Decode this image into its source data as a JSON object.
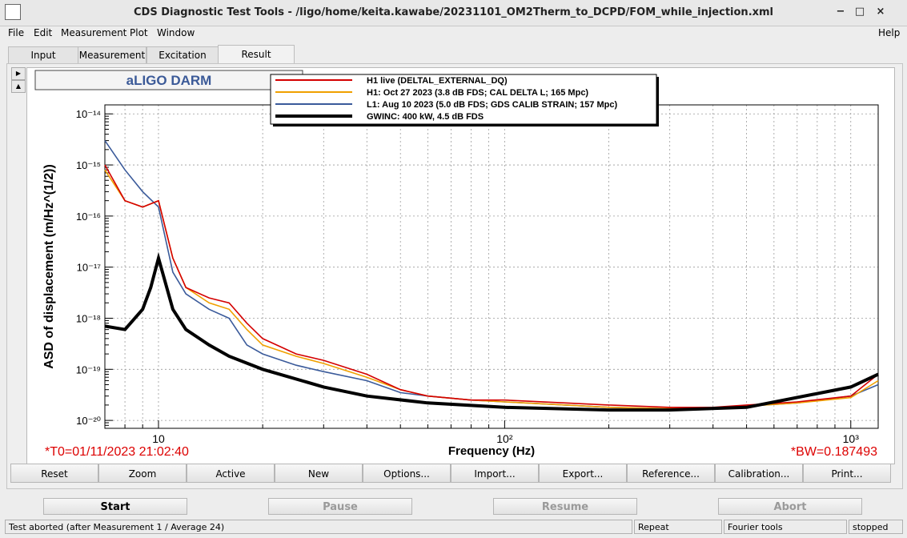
{
  "window": {
    "title": "CDS Diagnostic Test Tools - /ligo/home/keita.kawabe/20231101_OM2Therm_to_DCPD/FOM_while_injection.xml",
    "buttons": [
      "−",
      "□",
      "×"
    ]
  },
  "menubar": [
    "File",
    "Edit",
    "Measurement",
    "Plot",
    "Window"
  ],
  "help_label": "Help",
  "tabs": [
    {
      "label": "Input"
    },
    {
      "label": "Measurement"
    },
    {
      "label": "Excitation"
    },
    {
      "label": "Result",
      "active": true
    }
  ],
  "plot": {
    "title_box": "aLIGO DARM",
    "t0": "*T0=01/11/2023 21:02:40",
    "bw": "*BW=0.187493"
  },
  "colors": {
    "h1_live": "#d40000",
    "h1_oct": "#f0a000",
    "l1": "#3a5a9a",
    "gwinc": "#000000",
    "label_red": "#dd0000",
    "title_blue": "#3b5a98"
  },
  "chart_data": {
    "type": "line",
    "xlabel": "Frequency (Hz)",
    "ylabel": "ASD of displacement (m/Hz^(1/2))",
    "x_scale": "log",
    "y_scale": "log",
    "xlim": [
      7,
      1200
    ],
    "ylim": [
      7e-21,
      1.5e-14
    ],
    "xticks": [
      "10",
      "10²",
      "10³"
    ],
    "yticks": [
      "10⁻¹⁴",
      "10⁻¹⁵",
      "10⁻¹⁶",
      "10⁻¹⁷",
      "10⁻¹⁸",
      "10⁻¹⁹",
      "10⁻²⁰"
    ],
    "grid": true,
    "legend_position": "top-center",
    "series": [
      {
        "name": "H1 live (DELTAL_EXTERNAL_DQ)",
        "x": [
          7,
          8,
          9,
          10,
          11,
          12,
          14,
          16,
          18,
          20,
          25,
          30,
          40,
          50,
          60,
          80,
          100,
          150,
          200,
          300,
          400,
          500,
          700,
          1000,
          1200
        ],
        "y": [
          1e-15,
          2e-16,
          1.5e-16,
          2e-16,
          1.5e-17,
          4e-18,
          2.5e-18,
          2e-18,
          8e-19,
          4e-19,
          2e-19,
          1.5e-19,
          8e-20,
          4e-20,
          3e-20,
          2.5e-20,
          2.5e-20,
          2.2e-20,
          2e-20,
          1.8e-20,
          1.8e-20,
          2e-20,
          2.3e-20,
          3e-20,
          8e-20
        ]
      },
      {
        "name": "H1: Oct 27 2023 (3.8 dB FDS; CAL DELTA L; 165 Mpc)",
        "x": [
          7,
          8,
          9,
          10,
          11,
          12,
          14,
          16,
          18,
          20,
          25,
          30,
          40,
          50,
          60,
          80,
          100,
          150,
          200,
          300,
          400,
          500,
          700,
          1000,
          1200
        ],
        "y": [
          8e-16,
          2e-16,
          1.5e-16,
          2e-16,
          1.5e-17,
          4e-18,
          2e-18,
          1.5e-18,
          6e-19,
          3e-19,
          1.8e-19,
          1.3e-19,
          7e-20,
          4e-20,
          3e-20,
          2.5e-20,
          2.3e-20,
          2e-20,
          1.8e-20,
          1.7e-20,
          1.7e-20,
          1.9e-20,
          2.2e-20,
          2.8e-20,
          6e-20
        ]
      },
      {
        "name": "L1: Aug 10 2023 (5.0 dB FDS; GDS CALIB STRAIN; 157 Mpc)",
        "x": [
          7,
          8,
          9,
          10,
          11,
          12,
          14,
          16,
          18,
          20,
          25,
          30,
          40,
          50,
          60,
          80,
          100,
          150,
          200,
          300,
          400,
          500,
          700,
          1000,
          1200
        ],
        "y": [
          3e-15,
          8e-16,
          3e-16,
          1.5e-16,
          8e-18,
          3e-18,
          1.5e-18,
          1e-18,
          3e-19,
          2e-19,
          1.2e-19,
          9e-20,
          6e-20,
          3.5e-20,
          3e-20,
          2.5e-20,
          2.3e-20,
          2e-20,
          1.8e-20,
          1.7e-20,
          1.7e-20,
          1.9e-20,
          2.2e-20,
          3e-20,
          5e-20
        ]
      },
      {
        "name": "GWINC: 400 kW, 4.5 dB FDS",
        "x": [
          7,
          8,
          9,
          9.5,
          10,
          11,
          12,
          14,
          16,
          20,
          30,
          40,
          60,
          100,
          200,
          300,
          500,
          1000,
          1200
        ],
        "y": [
          7e-19,
          6e-19,
          1.5e-18,
          4e-18,
          1.5e-17,
          1.5e-18,
          6e-19,
          3e-19,
          1.8e-19,
          1e-19,
          4.5e-20,
          3e-20,
          2.2e-20,
          1.8e-20,
          1.6e-20,
          1.6e-20,
          1.8e-20,
          4.5e-20,
          8e-20
        ]
      }
    ]
  },
  "buttons": [
    "Reset",
    "Zoom",
    "Active",
    "New",
    "Options...",
    "Import...",
    "Export...",
    "Reference...",
    "Calibration...",
    "Print..."
  ],
  "controls": {
    "start": "Start",
    "pause": "Pause",
    "resume": "Resume",
    "abort": "Abort"
  },
  "status": {
    "message": "Test aborted (after Measurement 1 / Average 24)",
    "mode": "Repeat",
    "tool": "Fourier tools",
    "state": "stopped"
  }
}
